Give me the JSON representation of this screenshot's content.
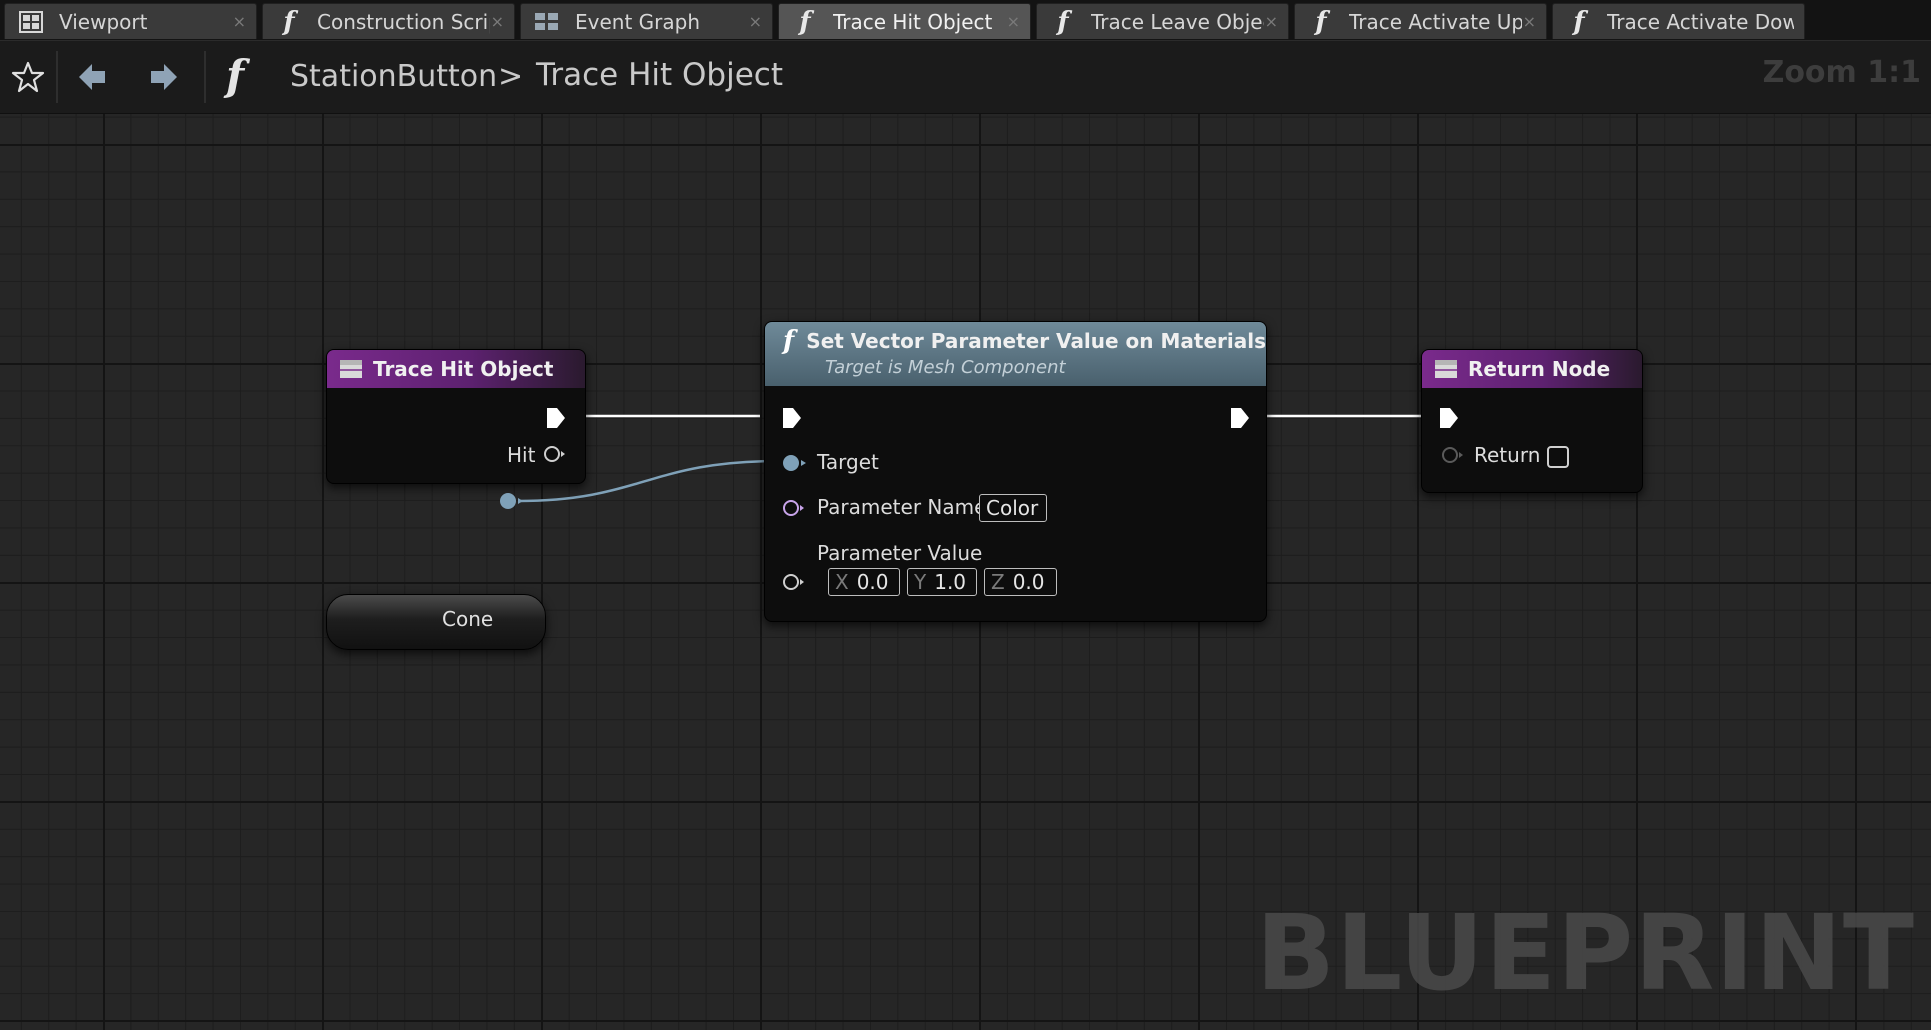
{
  "tabs": [
    {
      "label": "Viewport",
      "icon": "grid-window-icon",
      "active": false
    },
    {
      "label": "Construction Scrip",
      "icon": "function-icon",
      "active": false
    },
    {
      "label": "Event Graph",
      "icon": "graph-grid-icon",
      "active": false
    },
    {
      "label": "Trace Hit Object",
      "icon": "function-icon",
      "active": true
    },
    {
      "label": "Trace Leave Object",
      "icon": "function-icon",
      "active": false
    },
    {
      "label": "Trace Activate Up",
      "icon": "function-icon",
      "active": false
    },
    {
      "label": "Trace Activate Dow",
      "icon": "function-icon",
      "active": false
    }
  ],
  "tab_close_glyph": "×",
  "function_glyph": "f",
  "breadcrumb": {
    "parent": "StationButton",
    "separator": ">",
    "current": "Trace Hit Object"
  },
  "zoom_label": "Zoom 1:1",
  "nodes": {
    "entry": {
      "title": "Trace Hit Object",
      "hit_label": "Hit",
      "header_color": "#7a2a8c"
    },
    "set_vector": {
      "title": "Set Vector Parameter Value on Materials",
      "subtitle": "Target is Mesh Component",
      "target_label": "Target",
      "parameter_name_label": "Parameter Name",
      "parameter_name_value": "Color",
      "parameter_value_label": "Parameter Value",
      "x_axis": "X",
      "x_value": "0.0",
      "y_axis": "Y",
      "y_value": "1.0",
      "z_axis": "Z",
      "z_value": "0.0",
      "header_color": "#5b7483"
    },
    "return": {
      "title": "Return Node",
      "return_label": "Return",
      "return_checked": false,
      "header_color": "#7a2a8c"
    },
    "cone": {
      "label": "Cone"
    }
  },
  "colors": {
    "exec_wire": "#ffffff",
    "object_wire": "#7fa1b8",
    "name_pin": "#c8a4ea",
    "struct_pin": "#cfcfcf"
  },
  "watermark": "BLUEPRINT"
}
